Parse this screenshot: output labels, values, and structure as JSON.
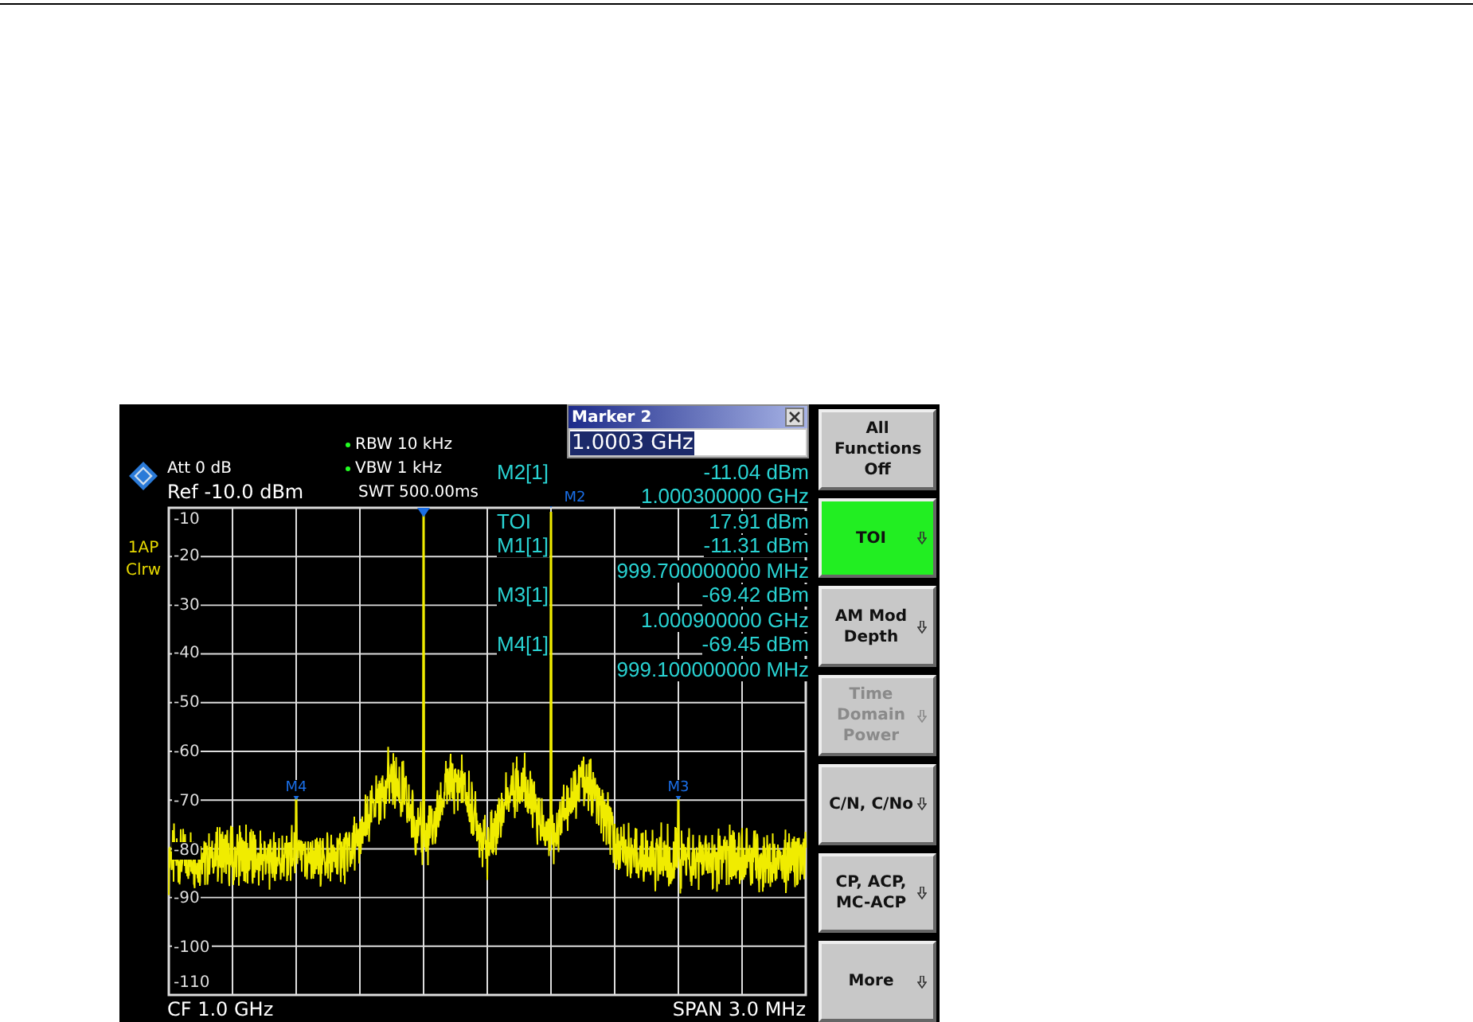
{
  "instrument": {
    "header": {
      "att": "Att  0 dB",
      "ref": "Ref -10.0 dBm",
      "rbw": "RBW  10 kHz",
      "vbw": "VBW  1 kHz",
      "swt": "SWT 500.00ms"
    },
    "trace_labels": [
      "1AP",
      "Clrw"
    ],
    "marker_dialog": {
      "title": "Marker 2",
      "value": "1.0003 GHz"
    },
    "readouts": [
      {
        "label": "M2[1]",
        "value": "-11.04 dBm"
      },
      {
        "value": "1.000300000 GHz"
      },
      {
        "label": "TOI",
        "value": "17.91 dBm"
      },
      {
        "label": "M1[1]",
        "value": "-11.31 dBm"
      },
      {
        "value": "999.700000000 MHz"
      },
      {
        "label": "M3[1]",
        "value": "-69.42 dBm"
      },
      {
        "value": "1.000900000 GHz"
      },
      {
        "label": "M4[1]",
        "value": "-69.45 dBm"
      },
      {
        "value": "999.100000000 MHz"
      }
    ],
    "y_axis_labels": [
      "-10",
      "-20",
      "-30",
      "-40",
      "-50",
      "-60",
      "-70",
      "-80",
      "-90",
      "-100",
      "-110"
    ],
    "markers": [
      {
        "label": "M4"
      },
      {
        "label": "M3"
      },
      {
        "label": "M2"
      }
    ],
    "footer": {
      "left": "CF 1.0 GHz",
      "right": "SPAN 3.0 MHz"
    },
    "softkeys": [
      {
        "label": "All Functions Off",
        "selected": false,
        "disabled": false,
        "submenu": false
      },
      {
        "label": "TOI",
        "selected": true,
        "disabled": false,
        "submenu": true
      },
      {
        "label": "AM Mod Depth",
        "selected": false,
        "disabled": false,
        "submenu": true
      },
      {
        "label": "Time Domain Power",
        "selected": false,
        "disabled": true,
        "submenu": true
      },
      {
        "label": "C/N, C/No",
        "selected": false,
        "disabled": false,
        "submenu": true
      },
      {
        "label": "CP, ACP, MC-ACP",
        "selected": false,
        "disabled": false,
        "submenu": true
      },
      {
        "label": "More",
        "selected": false,
        "disabled": false,
        "submenu": true
      }
    ]
  }
}
